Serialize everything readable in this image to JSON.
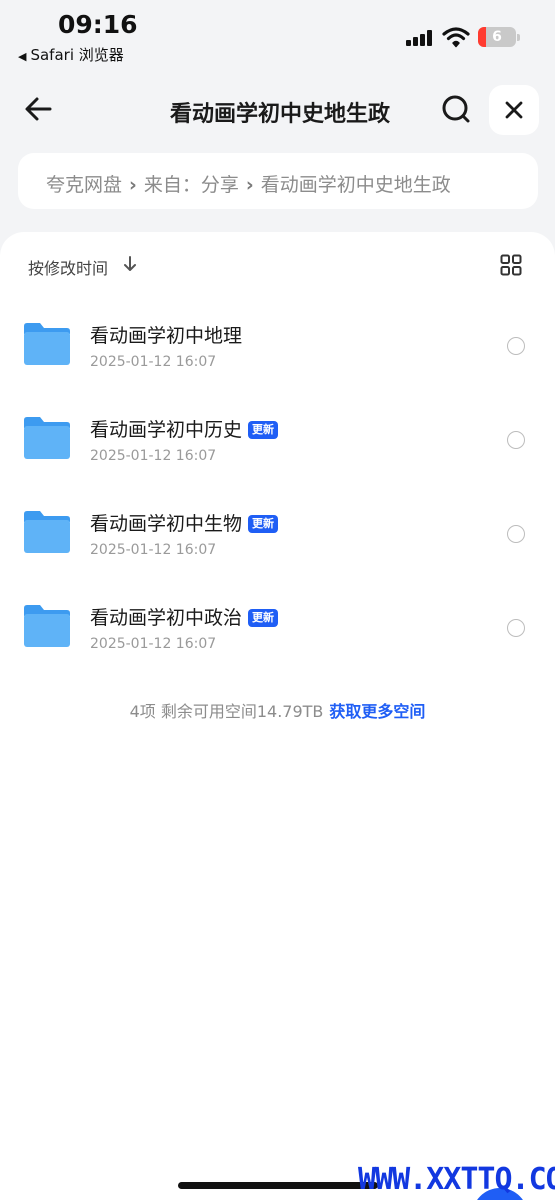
{
  "status_bar": {
    "time": "09:16",
    "back_app": "Safari 浏览器",
    "battery": "6"
  },
  "header": {
    "title": "看动画学初中史地生政",
    "back_icon": "back-arrow-icon",
    "search_icon": "search-icon",
    "close_icon": "close-icon"
  },
  "breadcrumb": {
    "items": [
      "夸克网盘",
      "来自：分享",
      "看动画学初中史地生政"
    ]
  },
  "toolbar": {
    "sort_label": "按修改时间",
    "sort_icon": "arrow-down-icon",
    "view_icon": "grid-view-icon"
  },
  "files": [
    {
      "name": "看动画学初中地理",
      "date": "2025-01-12 16:07",
      "badge": ""
    },
    {
      "name": "看动画学初中历史",
      "date": "2025-01-12 16:07",
      "badge": "更新"
    },
    {
      "name": "看动画学初中生物",
      "date": "2025-01-12 16:07",
      "badge": "更新"
    },
    {
      "name": "看动画学初中政治",
      "date": "2025-01-12 16:07",
      "badge": "更新"
    }
  ],
  "footer": {
    "info": "4项 剩余可用空间14.79TB",
    "link": "获取更多空间"
  },
  "watermark": "WWW.XXTTQ.COM",
  "colors": {
    "accent": "#1f5ef5",
    "folder": "#5aaef5",
    "background": "#f3f4f6"
  }
}
